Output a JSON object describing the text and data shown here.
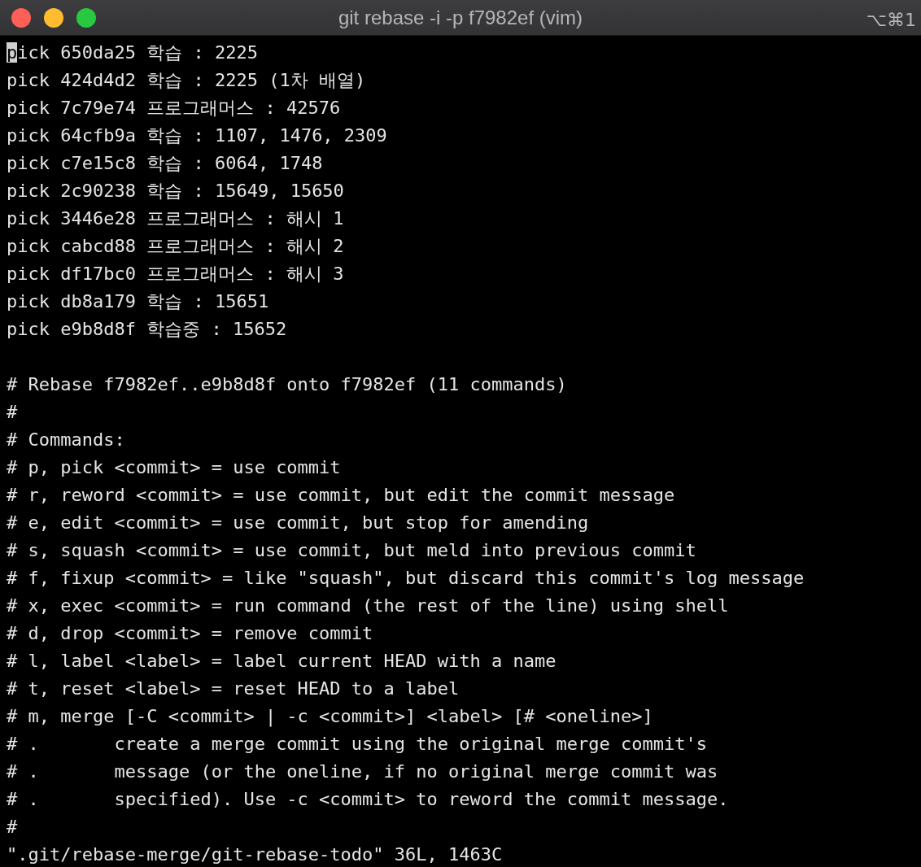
{
  "window": {
    "title": "git rebase -i -p f7982ef (vim)",
    "shortcut": "⌥⌘1"
  },
  "todo_lines": [
    {
      "text": "pick 650da25 학습 : 2225",
      "cursor": true
    },
    {
      "text": "pick 424d4d2 학습 : 2225 (1차 배열)",
      "cursor": false
    },
    {
      "text": "pick 7c79e74 프로그래머스 : 42576",
      "cursor": false
    },
    {
      "text": "pick 64cfb9a 학습 : 1107, 1476, 2309",
      "cursor": false
    },
    {
      "text": "pick c7e15c8 학습 : 6064, 1748",
      "cursor": false
    },
    {
      "text": "pick 2c90238 학습 : 15649, 15650",
      "cursor": false
    },
    {
      "text": "pick 3446e28 프로그래머스 : 해시 1",
      "cursor": false
    },
    {
      "text": "pick cabcd88 프로그래머스 : 해시 2",
      "cursor": false
    },
    {
      "text": "pick df17bc0 프로그래머스 : 해시 3",
      "cursor": false
    },
    {
      "text": "pick db8a179 학습 : 15651",
      "cursor": false
    },
    {
      "text": "pick e9b8d8f 학습중 : 15652",
      "cursor": false
    }
  ],
  "comment_lines": [
    "# Rebase f7982ef..e9b8d8f onto f7982ef (11 commands)",
    "#",
    "# Commands:",
    "# p, pick <commit> = use commit",
    "# r, reword <commit> = use commit, but edit the commit message",
    "# e, edit <commit> = use commit, but stop for amending",
    "# s, squash <commit> = use commit, but meld into previous commit",
    "# f, fixup <commit> = like \"squash\", but discard this commit's log message",
    "# x, exec <commit> = run command (the rest of the line) using shell",
    "# d, drop <commit> = remove commit",
    "# l, label <label> = label current HEAD with a name",
    "# t, reset <label> = reset HEAD to a label",
    "# m, merge [-C <commit> | -c <commit>] <label> [# <oneline>]",
    "# .       create a merge commit using the original merge commit's",
    "# .       message (or the oneline, if no original merge commit was",
    "# .       specified). Use -c <commit> to reword the commit message.",
    "#"
  ],
  "status_line": "\".git/rebase-merge/git-rebase-todo\" 36L, 1463C"
}
